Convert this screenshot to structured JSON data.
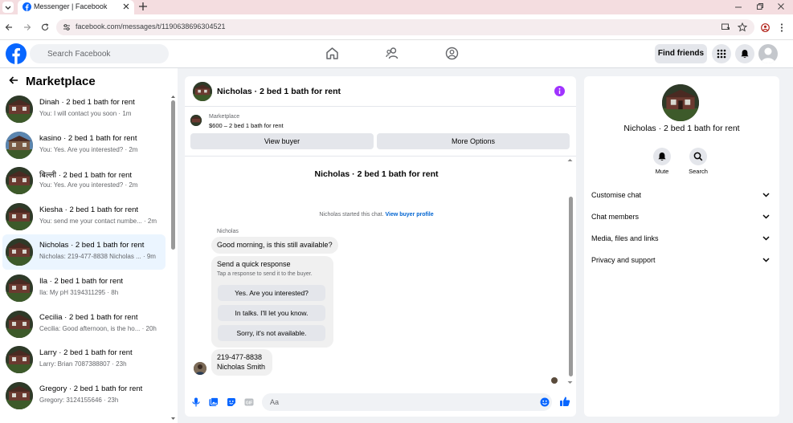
{
  "browser": {
    "tab_title": "Messenger | Facebook",
    "url": "facebook.com/messages/t/1190638696304521"
  },
  "topnav": {
    "search_placeholder": "Search Facebook",
    "find_friends": "Find friends"
  },
  "sidebar": {
    "title": "Marketplace",
    "conversations": [
      {
        "title": "Dinah · 2 bed 1 bath for rent",
        "snippet": "You: I will contact you soon · 1m",
        "active": false
      },
      {
        "title": "kasino · 2 bed 1 bath for rent",
        "snippet": "You: Yes. Are you interested? · 2m",
        "active": false
      },
      {
        "title": "बिल्ली · 2 bed 1 bath for rent",
        "snippet": "You: Yes. Are you interested? · 2m",
        "active": false
      },
      {
        "title": "Kiesha · 2 bed 1 bath for rent",
        "snippet": "You: send me your contact numbe... · 2m",
        "active": false
      },
      {
        "title": "Nicholas · 2 bed 1 bath for rent",
        "snippet": "Nicholas: 219-477-8838 Nicholas ... · 9m",
        "active": true
      },
      {
        "title": "Ila · 2 bed 1 bath for rent",
        "snippet": "Ila: My pH 3194311295 · 8h",
        "active": false
      },
      {
        "title": "Cecilia · 2 bed 1 bath for rent",
        "snippet": "Cecilia: Good afternoon, is the ho... · 20h",
        "active": false
      },
      {
        "title": "Larry · 2 bed 1 bath for rent",
        "snippet": "Larry: Brian 7087388807 · 23h",
        "active": false
      },
      {
        "title": "Gregory · 2 bed 1 bath for rent",
        "snippet": "Gregory: 3124155646 · 23h",
        "active": false
      }
    ]
  },
  "chat": {
    "header_title": "Nicholas · 2 bed 1 bath for rent",
    "listing_kind": "Marketplace",
    "listing_price": "$600 – 2 bed 1 bath for rent",
    "view_buyer": "View buyer",
    "more_options": "More Options",
    "big_title": "Nicholas · 2 bed 1 bath for rent",
    "started_text": "Nicholas started this chat.",
    "view_buyer_profile": "View buyer profile",
    "sender_name": "Nicholas",
    "message1": "Good morning, is this still available?",
    "quick_title": "Send a quick response",
    "quick_sub": "Tap a response to send it to the buyer.",
    "quick_replies": [
      "Yes. Are you interested?",
      "In talks. I'll let you know.",
      "Sorry, it's not available."
    ],
    "message2_line1": "219-477-8838",
    "message2_line2": "Nicholas Smith",
    "input_placeholder": "Aa"
  },
  "rpanel": {
    "name": "Nicholas · 2 bed 1 bath for rent",
    "mute": "Mute",
    "search": "Search",
    "rows": [
      "Customise chat",
      "Chat members",
      "Media, files and links",
      "Privacy and support"
    ]
  },
  "colors": {
    "brand": "#0866ff",
    "active_row": "#ebf5ff",
    "info_purple": "#a033ff",
    "link": "#0064d1"
  }
}
